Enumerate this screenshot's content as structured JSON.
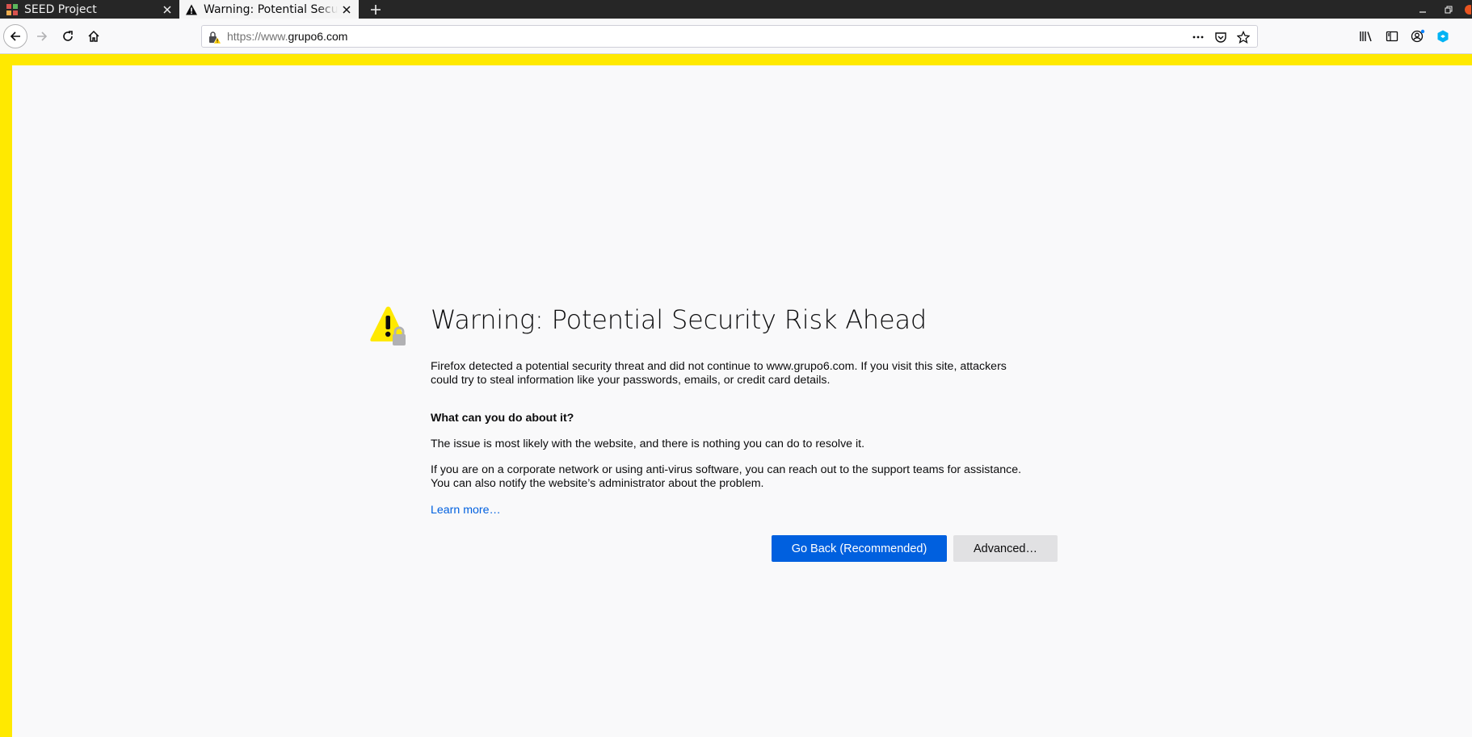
{
  "tabs": [
    {
      "title": "SEED Project",
      "active": false,
      "icon": "seed-favicon"
    },
    {
      "title": "Warning: Potential Security Risk Ahead",
      "active": true,
      "icon": "warning-icon"
    }
  ],
  "navbar": {
    "url_scheme": "https://www.",
    "url_host": "grupo6.com",
    "url_full": "https://www.grupo6.com"
  },
  "error_page": {
    "title": "Warning: Potential Security Risk Ahead",
    "description": "Firefox detected a potential security threat and did not continue to www.grupo6.com. If you visit this site, attackers could try to steal information like your passwords, emails, or credit card details.",
    "subheading": "What can you do about it?",
    "paragraph1": "The issue is most likely with the website, and there is nothing you can do to resolve it.",
    "paragraph2": "If you are on a corporate network or using anti-virus software, you can reach out to the support teams for assistance. You can also notify the website’s administrator about the problem.",
    "learn_more": "Learn more…",
    "go_back_label": "Go Back (Recommended)",
    "advanced_label": "Advanced…"
  },
  "colors": {
    "border_warning": "#ffe900",
    "primary_button": "#0060df",
    "link": "#0060df",
    "tabstrip": "#262626"
  }
}
